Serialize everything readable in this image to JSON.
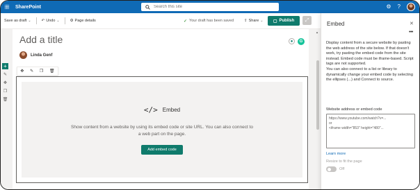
{
  "suite_bar": {
    "app_name": "SharePoint",
    "search_placeholder": "Search this site",
    "icons": [
      "waffle-icon",
      "search-icon",
      "settings-icon",
      "help-icon"
    ]
  },
  "command_bar": {
    "save_as_draft": "Save as draft",
    "undo": "Undo",
    "page_details": "Page details",
    "draft_status": "Your draft has been saved",
    "share": "Share",
    "publish": "Publish"
  },
  "page": {
    "title_placeholder": "Add a title",
    "author_name": "Linda Genf"
  },
  "embed_webpart": {
    "icon_glyph": "</>",
    "heading": "Embed",
    "description": "Show content from a website by using its embed code or site URL. You can also connect to a web part on the page.",
    "button": "Add embed code"
  },
  "property_pane": {
    "title": "Embed",
    "more_glyph": "•••",
    "paragraph_1": "Display content from a secure website by pasting the web address of the site below. If that doesn't work, try pasting the embed code from the site instead. Embed code must be iframe-based. Script tags are not supported.",
    "paragraph_2": "You can also connect to a list or library to dynamically change your embed code by selecting the ellipses (...) and Connect to source.",
    "field_label": "Website address or embed code",
    "field_placeholder_line1": "https://www.youtube.com/watch?v=...",
    "field_placeholder_line2": "or",
    "field_placeholder_line3": "<iframe width=\"853\" height=\"480\"...",
    "learn_more": "Learn more",
    "resize_label": "Resize to fit the page",
    "resize_state": "Off"
  },
  "colors": {
    "suite_bar": "#0f6ab5",
    "accent": "#0f7b6c",
    "canvas": "#f3f2f1"
  }
}
